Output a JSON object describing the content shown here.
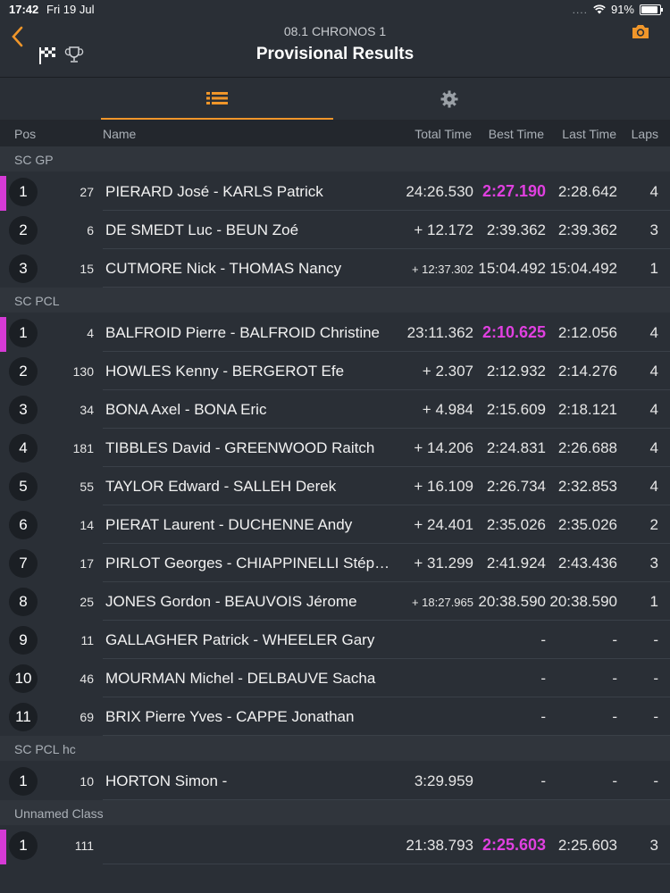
{
  "status": {
    "time": "17:42",
    "date": "Fri 19 Jul",
    "signal": "....",
    "battery": "91%"
  },
  "header": {
    "subtitle": "08.1 CHRONOS 1",
    "title": "Provisional Results"
  },
  "columns": {
    "pos": "Pos",
    "name": "Name",
    "total": "Total Time",
    "best": "Best Time",
    "last": "Last Time",
    "laps": "Laps"
  },
  "colors": {
    "accent": "#f0962a",
    "best_highlight": "#e040e0",
    "leader_mark": "#d63ad6"
  },
  "classes": [
    {
      "label": "SC GP",
      "rows": [
        {
          "pos": "1",
          "num": "27",
          "name": "PIERARD José - KARLS Patrick",
          "total": "24:26.530",
          "best": "2:27.190",
          "last": "2:28.642",
          "laps": "4",
          "hl": true
        },
        {
          "pos": "2",
          "num": "6",
          "name": "DE SMEDT Luc -  BEUN Zoé",
          "total": "+ 12.172",
          "best": "2:39.362",
          "last": "2:39.362",
          "laps": "3"
        },
        {
          "pos": "3",
          "num": "15",
          "name": "CUTMORE Nick - THOMAS Nancy",
          "total": "+ 12:37.302",
          "best": "15:04.492",
          "last": "15:04.492",
          "laps": "1",
          "small": true
        }
      ]
    },
    {
      "label": "SC PCL",
      "rows": [
        {
          "pos": "1",
          "num": "4",
          "name": "BALFROID Pierre - BALFROID Christine",
          "total": "23:11.362",
          "best": "2:10.625",
          "last": "2:12.056",
          "laps": "4",
          "hl": true
        },
        {
          "pos": "2",
          "num": "130",
          "name": "HOWLES Kenny - BERGEROT Efe",
          "total": "+ 2.307",
          "best": "2:12.932",
          "last": "2:14.276",
          "laps": "4"
        },
        {
          "pos": "3",
          "num": "34",
          "name": "BONA Axel - BONA Eric",
          "total": "+ 4.984",
          "best": "2:15.609",
          "last": "2:18.121",
          "laps": "4"
        },
        {
          "pos": "4",
          "num": "181",
          "name": "TIBBLES David - GREENWOOD Raitch",
          "total": "+ 14.206",
          "best": "2:24.831",
          "last": "2:26.688",
          "laps": "4"
        },
        {
          "pos": "5",
          "num": "55",
          "name": "TAYLOR Edward - SALLEH Derek",
          "total": "+ 16.109",
          "best": "2:26.734",
          "last": "2:32.853",
          "laps": "4"
        },
        {
          "pos": "6",
          "num": "14",
          "name": "PIERAT Laurent - DUCHENNE Andy",
          "total": "+ 24.401",
          "best": "2:35.026",
          "last": "2:35.026",
          "laps": "2"
        },
        {
          "pos": "7",
          "num": "17",
          "name": "PIRLOT Georges - CHIAPPINELLI Stéphane",
          "total": "+ 31.299",
          "best": "2:41.924",
          "last": "2:43.436",
          "laps": "3"
        },
        {
          "pos": "8",
          "num": "25",
          "name": "JONES Gordon - BEAUVOIS Jérome",
          "total": "+ 18:27.965",
          "best": "20:38.590",
          "last": "20:38.590",
          "laps": "1",
          "small": true
        },
        {
          "pos": "9",
          "num": "11",
          "name": "GALLAGHER Patrick - WHEELER Gary",
          "total": "",
          "best": "-",
          "last": "-",
          "laps": "-"
        },
        {
          "pos": "10",
          "num": "46",
          "name": "MOURMAN Michel - DELBAUVE Sacha",
          "total": "",
          "best": "-",
          "last": "-",
          "laps": "-"
        },
        {
          "pos": "11",
          "num": "69",
          "name": "BRIX Pierre Yves - CAPPE Jonathan",
          "total": "",
          "best": "-",
          "last": "-",
          "laps": "-"
        }
      ]
    },
    {
      "label": "SC PCL hc",
      "rows": [
        {
          "pos": "1",
          "num": "10",
          "name": "HORTON Simon -",
          "total": "3:29.959",
          "best": "-",
          "last": "-",
          "laps": "-"
        }
      ]
    },
    {
      "label": "Unnamed Class",
      "rows": [
        {
          "pos": "1",
          "num": "111",
          "name": "",
          "total": "21:38.793",
          "best": "2:25.603",
          "last": "2:25.603",
          "laps": "3",
          "hl": true
        }
      ]
    }
  ]
}
